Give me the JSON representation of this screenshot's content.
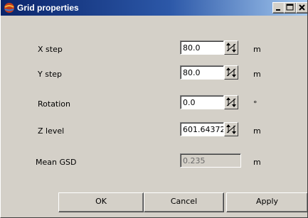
{
  "window": {
    "title": "Grid properties"
  },
  "fields": [
    {
      "label": "X step",
      "value": "80.0",
      "unit": "m"
    },
    {
      "label": "Y step",
      "value": "80.0",
      "unit": "m"
    },
    {
      "label": "Rotation",
      "value": "0.0",
      "unit": "°"
    },
    {
      "label": "Z level",
      "value": "601.64372",
      "unit": "m"
    }
  ],
  "mean_gsd": {
    "label": "Mean GSD",
    "value": "0.235",
    "unit": "m"
  },
  "buttons": {
    "ok": "OK",
    "cancel": "Cancel",
    "apply": "Apply"
  },
  "icons": {
    "app": "globe-icon",
    "minimize": "minimize-icon",
    "maximize": "maximize-icon",
    "close": "close-icon",
    "spin": "spin-arrows-icon"
  }
}
